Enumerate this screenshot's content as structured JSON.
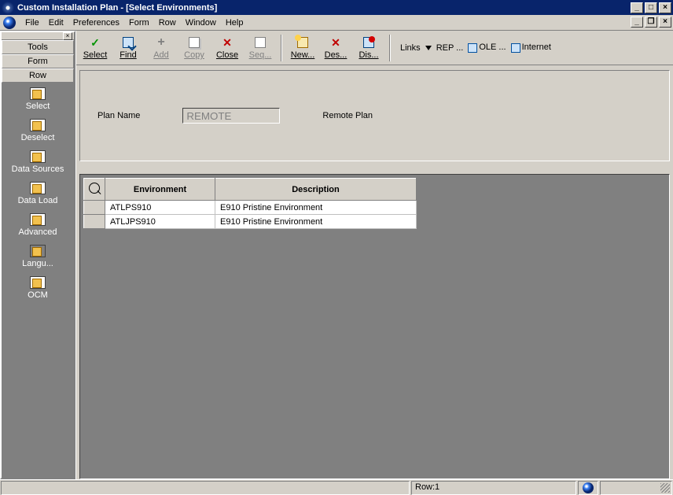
{
  "window": {
    "title": "Custom Installation Plan - [Select Environments]"
  },
  "menubar": [
    "File",
    "Edit",
    "Preferences",
    "Form",
    "Row",
    "Window",
    "Help"
  ],
  "toolbar": {
    "select": "Select",
    "find": "Find",
    "add": "Add",
    "copy": "Copy",
    "close": "Close",
    "seq": "Seq...",
    "new": "New...",
    "des": "Des...",
    "dis": "Dis..."
  },
  "links": {
    "label": "Links",
    "items": [
      "REP ...",
      "OLE ...",
      "Internet"
    ]
  },
  "sidebar": {
    "buttons": [
      "Tools",
      "Form",
      "Row"
    ],
    "actions": [
      "Select",
      "Deselect",
      "Data Sources",
      "Data Load",
      "Advanced",
      "Langu...",
      "OCM"
    ]
  },
  "form": {
    "plan_name_label": "Plan Name",
    "plan_name_value": "REMOTE",
    "plan_desc": "Remote Plan"
  },
  "grid": {
    "headers": {
      "env": "Environment",
      "desc": "Description"
    },
    "rows": [
      {
        "env": "ATLPS910",
        "desc": "E910 Pristine Environment"
      },
      {
        "env": "ATLJPS910",
        "desc": "E910 Pristine Environment"
      }
    ]
  },
  "status": {
    "row": "Row:1"
  }
}
